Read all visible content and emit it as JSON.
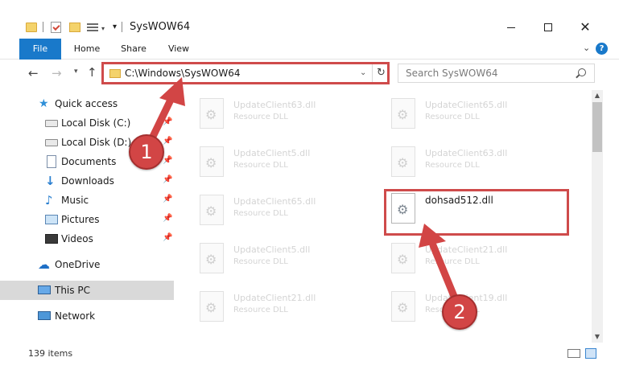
{
  "window": {
    "title": "SysWOW64"
  },
  "ribbon": {
    "tabs": [
      {
        "label": "File"
      },
      {
        "label": "Home"
      },
      {
        "label": "Share"
      },
      {
        "label": "View"
      }
    ],
    "help": "?"
  },
  "address": {
    "path": "C:\\Windows\\SysWOW64",
    "search_placeholder": "Search SysWOW64"
  },
  "sidebar": {
    "items": [
      {
        "label": "Quick access",
        "icon": "star-icon"
      },
      {
        "label": "Local Disk (C:)",
        "icon": "disk-icon",
        "pinned": true
      },
      {
        "label": "Local Disk (D:)",
        "icon": "disk-icon",
        "pinned": true
      },
      {
        "label": "Documents",
        "icon": "documents-icon",
        "pinned": true
      },
      {
        "label": "Downloads",
        "icon": "download-icon",
        "pinned": true
      },
      {
        "label": "Music",
        "icon": "music-icon",
        "pinned": true
      },
      {
        "label": "Pictures",
        "icon": "pictures-icon",
        "pinned": true
      },
      {
        "label": "Videos",
        "icon": "videos-icon",
        "pinned": true
      },
      {
        "label": "OneDrive",
        "icon": "cloud-icon"
      },
      {
        "label": "This PC",
        "icon": "pc-icon",
        "selected": true
      },
      {
        "label": "Network",
        "icon": "network-icon"
      }
    ]
  },
  "files": [
    {
      "name": "UpdateClient63.dll",
      "type": "Resource DLL",
      "faded": true
    },
    {
      "name": "UpdateClient65.dll",
      "type": "Resource DLL",
      "faded": true
    },
    {
      "name": "UpdateClient5.dll",
      "type": "Resource DLL",
      "faded": true
    },
    {
      "name": "UpdateClient63.dll",
      "type": "Resource DLL",
      "faded": true
    },
    {
      "name": "UpdateClient65.dll",
      "type": "Resource DLL",
      "faded": true
    },
    {
      "name": "dohsad512.dll",
      "type": "",
      "faded": false
    },
    {
      "name": "UpdateClient5.dll",
      "type": "Resource DLL",
      "faded": true
    },
    {
      "name": "UpdateClient21.dll",
      "type": "Resource DLL",
      "faded": true
    },
    {
      "name": "UpdateClient21.dll",
      "type": "Resource DLL",
      "faded": true
    },
    {
      "name": "UpdateClient19.dll",
      "type": "Resource DLL",
      "faded": true
    }
  ],
  "status": {
    "item_count": "139 items"
  },
  "annotations": {
    "badge_1": "1",
    "badge_2": "2",
    "color": "#d24545"
  },
  "colors": {
    "accent": "#1979ca",
    "highlight": "#cf4b4b"
  }
}
